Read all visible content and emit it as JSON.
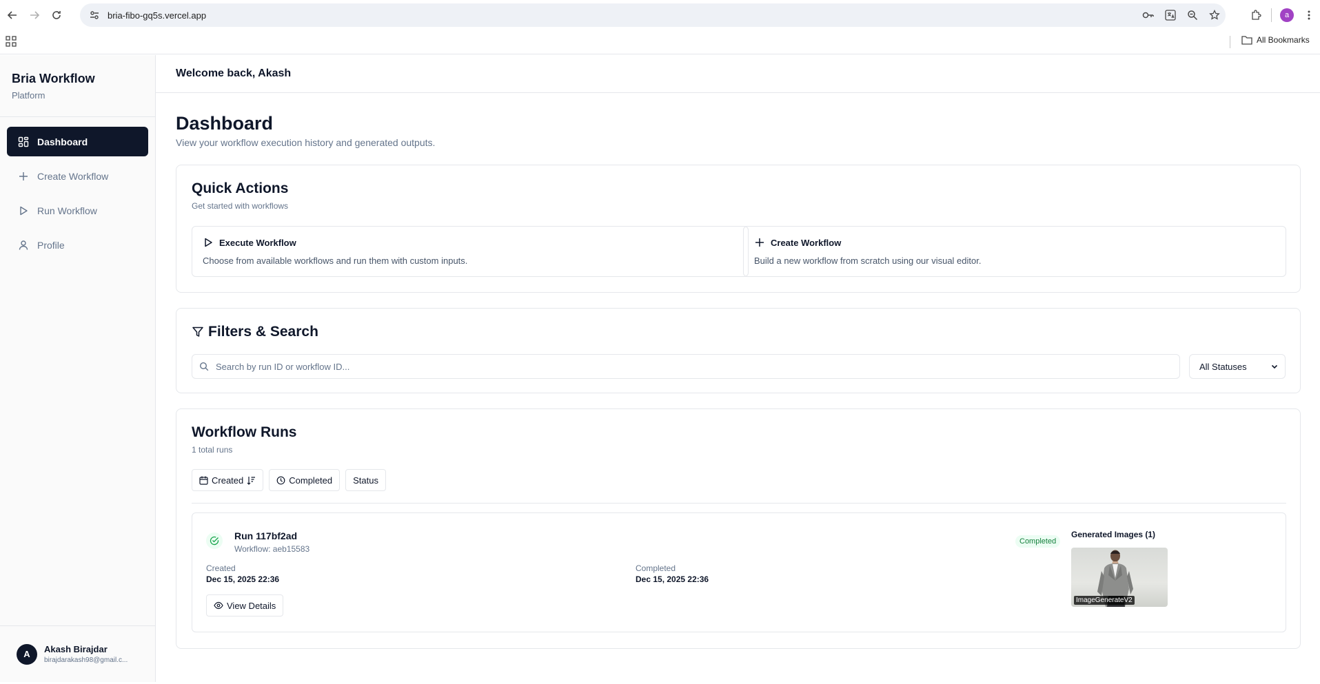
{
  "browser": {
    "url": "bria-fibo-gq5s.vercel.app",
    "profile_initial": "a",
    "all_bookmarks": "All Bookmarks"
  },
  "sidebar": {
    "brand_title": "Bria Workflow",
    "brand_subtitle": "Platform",
    "items": [
      {
        "label": "Dashboard",
        "icon": "grid-icon",
        "active": true
      },
      {
        "label": "Create Workflow",
        "icon": "plus-icon",
        "active": false
      },
      {
        "label": "Run Workflow",
        "icon": "play-icon",
        "active": false
      },
      {
        "label": "Profile",
        "icon": "user-icon",
        "active": false
      }
    ],
    "user": {
      "initial": "A",
      "name": "Akash Birajdar",
      "email": "birajdarakash98@gmail.c..."
    }
  },
  "header": {
    "welcome": "Welcome back, Akash"
  },
  "page": {
    "title": "Dashboard",
    "subtitle": "View your workflow execution history and generated outputs."
  },
  "quick_actions": {
    "title": "Quick Actions",
    "subtitle": "Get started with workflows",
    "tiles": [
      {
        "title": "Execute Workflow",
        "description": "Choose from available workflows and run them with custom inputs.",
        "icon": "play-icon"
      },
      {
        "title": "Create Workflow",
        "description": "Build a new workflow from scratch using our visual editor.",
        "icon": "plus-icon"
      }
    ]
  },
  "filters": {
    "title": "Filters & Search",
    "search_placeholder": "Search by run ID or workflow ID...",
    "status_selected": "All Statuses"
  },
  "runs": {
    "title": "Workflow Runs",
    "count_text": "1 total runs",
    "sort_buttons": [
      "Created",
      "Completed",
      "Status"
    ],
    "items": [
      {
        "name": "Run 117bf2ad",
        "workflow": "Workflow: aeb15583",
        "created_label": "Created",
        "created_value": "Dec 15, 2025 22:36",
        "completed_label": "Completed",
        "completed_value": "Dec 15, 2025 22:36",
        "status": "Completed",
        "view_details": "View Details",
        "generated_title": "Generated Images (1)",
        "image_label": "ImageGenerateV2"
      }
    ]
  },
  "colors": {
    "primary": "#0f172a",
    "muted": "#64748b",
    "border": "#e5e7eb",
    "success": "#16a34a",
    "success_bg": "#ecfdf3"
  }
}
